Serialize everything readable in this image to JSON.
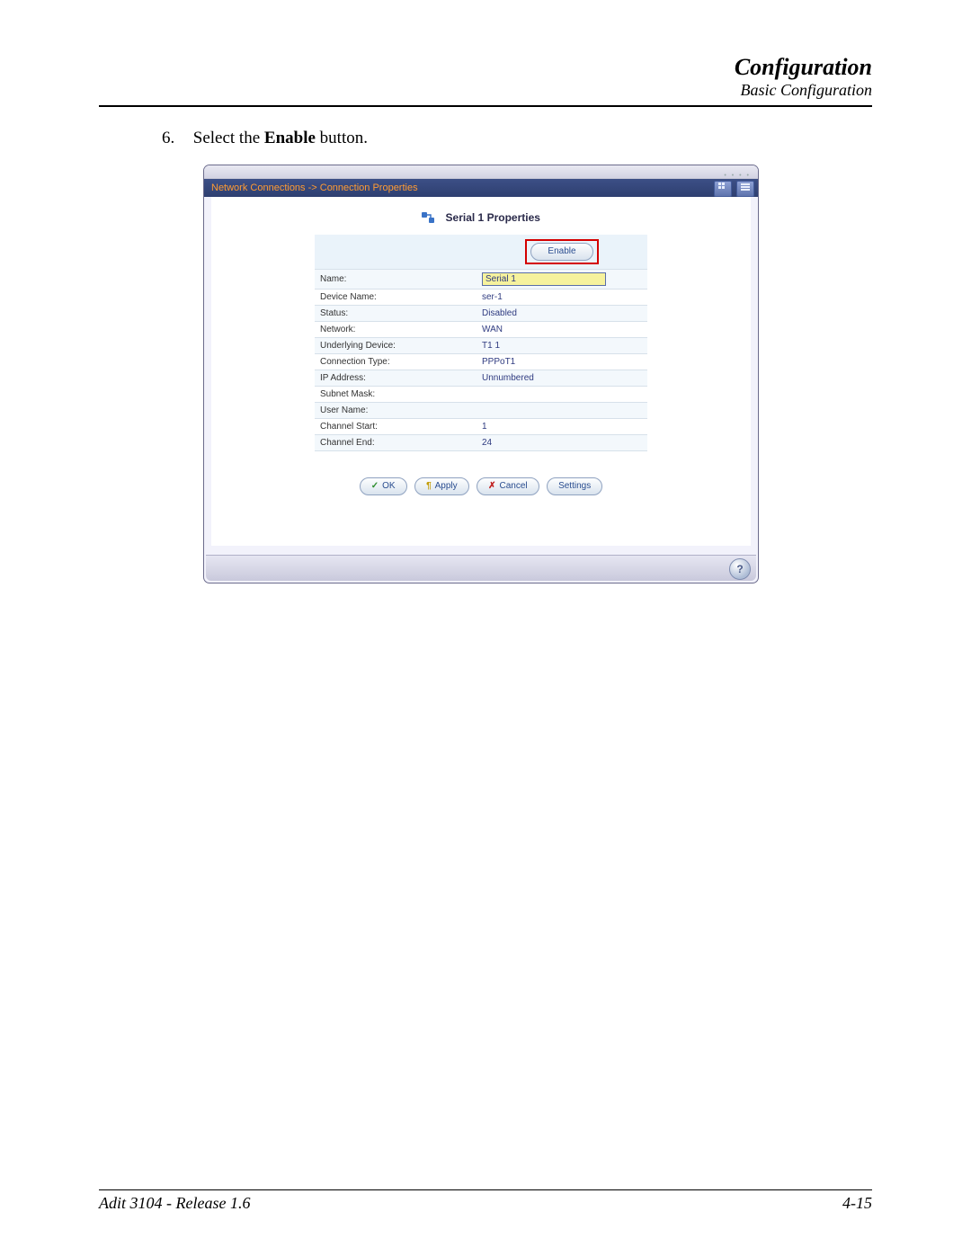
{
  "header": {
    "title": "Configuration",
    "subtitle": "Basic Configuration"
  },
  "step": {
    "number": "6.",
    "pre_text": "Select the ",
    "bold_text": "Enable",
    "post_text": " button."
  },
  "window": {
    "breadcrumb": "Network Connections -> Connection Properties",
    "panel_title": "Serial 1 Properties",
    "enable_button": "Enable",
    "rows": [
      {
        "label": "Name:",
        "value": "Serial 1",
        "input": true
      },
      {
        "label": "Device Name:",
        "value": "ser-1"
      },
      {
        "label": "Status:",
        "value": "Disabled"
      },
      {
        "label": "Network:",
        "value": "WAN"
      },
      {
        "label": "Underlying Device:",
        "value": "T1 1"
      },
      {
        "label": "Connection Type:",
        "value": "PPPoT1"
      },
      {
        "label": "IP Address:",
        "value": "Unnumbered"
      },
      {
        "label": "Subnet Mask:",
        "value": ""
      },
      {
        "label": "User Name:",
        "value": ""
      },
      {
        "label": "Channel Start:",
        "value": "1"
      },
      {
        "label": "Channel End:",
        "value": "24"
      }
    ],
    "buttons": {
      "ok": "OK",
      "apply": "Apply",
      "cancel": "Cancel",
      "settings": "Settings"
    },
    "help": "?"
  },
  "footer": {
    "left": "Adit 3104 - Release 1.6",
    "right": "4-15"
  }
}
